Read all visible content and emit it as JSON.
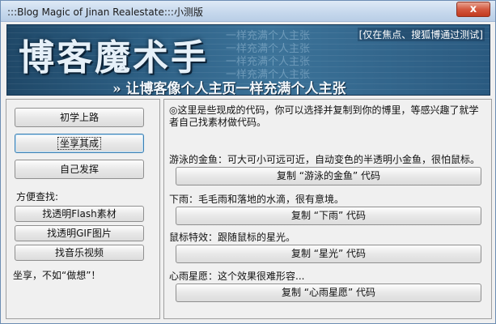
{
  "window": {
    "title": ":::Blog Magic of Jinan Realestate:::小测版",
    "close_label": "x"
  },
  "banner": {
    "title": "博客魔术手",
    "slogan": "» 让博客像个人主页一样充满个人主张",
    "notice": "[仅在焦点、搜狐博通过测试]",
    "bg_text": [
      "一样充满个人主张",
      "一样充满个人主张",
      "一样充满个人主张",
      "一样充满个人主张"
    ]
  },
  "left": {
    "buttons": {
      "beginner": "初学上路",
      "reap": "坐享其成",
      "create": "自己发挥"
    },
    "search_label": "方便查找:",
    "search_buttons": {
      "flash": "找透明Flash素材",
      "gif": "找透明GIF图片",
      "music": "找音乐视频"
    },
    "footer_text": "坐享，不如“做想”！"
  },
  "right": {
    "intro": "◎这里是些现成的代码，你可以选择并复制到你的博里，等感兴趣了就学者自己找素材做代码。",
    "effects": [
      {
        "desc": "游泳的金鱼：可大可小可远可近，自动变色的半透明小金鱼，很怕鼠标。",
        "button": "复制 “游泳的金鱼” 代码"
      },
      {
        "desc": "下雨：毛毛雨和落地的水滴，很有意境。",
        "button": "复制 “下雨” 代码"
      },
      {
        "desc": "鼠标特效：跟随鼠标的星光。",
        "button": "复制 “星光” 代码"
      },
      {
        "desc": "心雨星愿：这个效果很难形容...",
        "button": "复制 “心雨星愿” 代码"
      }
    ]
  }
}
